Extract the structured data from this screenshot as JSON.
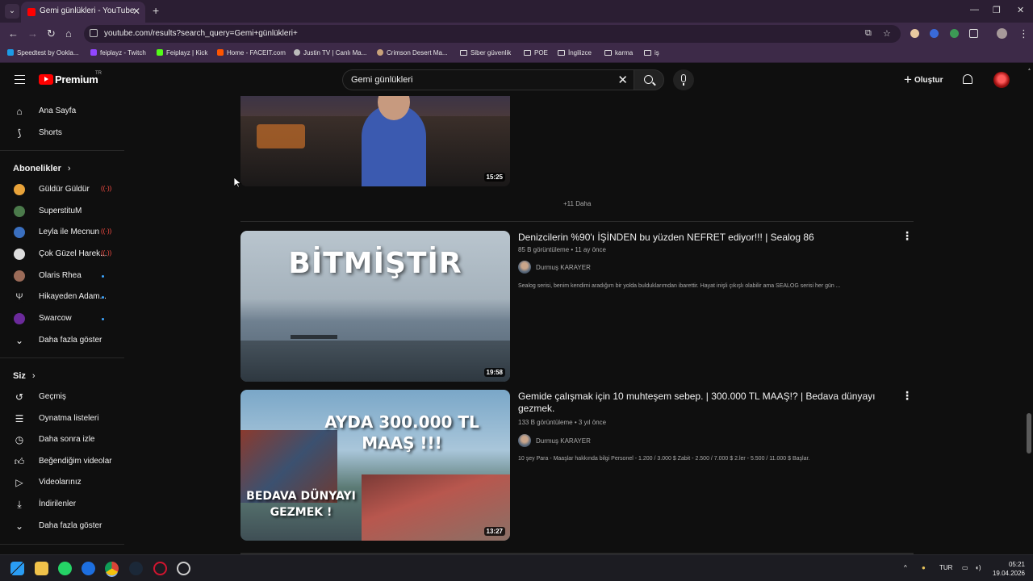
{
  "browser": {
    "tab_title": "Gemi günlükleri - YouTube",
    "url": "youtube.com/results?search_query=Gemi+günlükleri+",
    "bookmarks": [
      {
        "label": "Speedtest by Ookla...",
        "color": "#1c9be6",
        "folder": false
      },
      {
        "label": "feiplayz - Twitch",
        "color": "#9146ff",
        "folder": false
      },
      {
        "label": "Feiplayz | Kick",
        "color": "#53fc18",
        "folder": false
      },
      {
        "label": "Home - FACEIT.com",
        "color": "#ff5500",
        "folder": false
      },
      {
        "label": "Justin TV | Canlı Ma...",
        "color": "#bbbbbb",
        "folder": false
      },
      {
        "label": "Crimson Desert Ma...",
        "color": "#c9a27a",
        "folder": false
      },
      {
        "label": "Siber güvenlik",
        "color": "",
        "folder": true
      },
      {
        "label": "POE",
        "color": "",
        "folder": true
      },
      {
        "label": "İngilizce",
        "color": "",
        "folder": true
      },
      {
        "label": "karma",
        "color": "",
        "folder": true
      },
      {
        "label": "iş",
        "color": "",
        "folder": true
      }
    ]
  },
  "header": {
    "brand": "Premium",
    "region": "TR",
    "search_value": "Gemi günlükleri",
    "create_label": "Oluştur"
  },
  "sidebar": {
    "top": [
      {
        "label": "Ana Sayfa",
        "icon": "home-icon"
      },
      {
        "label": "Shorts",
        "icon": "shorts-icon"
      }
    ],
    "subscriptions_title": "Abonelikler",
    "subscriptions": [
      {
        "label": "Güldür Güldür",
        "indicator": "live",
        "color": "#e8a33a"
      },
      {
        "label": "SuperstituM",
        "indicator": "none",
        "color": "#4b7a4b"
      },
      {
        "label": "Leyla ile Mecnun",
        "indicator": "live",
        "color": "#3a6fbf"
      },
      {
        "label": "Çok Güzel Harek...",
        "indicator": "live",
        "color": "#dddddd"
      },
      {
        "label": "Olaris Rhea",
        "indicator": "dot",
        "color": "#9b6b58"
      },
      {
        "label": "Hikayeden Adam...",
        "indicator": "dot",
        "color": "#cccccc"
      },
      {
        "label": "Swarcow",
        "indicator": "dot",
        "color": "#6b2a9b"
      }
    ],
    "show_more": "Daha fazla göster",
    "you_title": "Siz",
    "you_items": [
      {
        "label": "Geçmiş",
        "icon": "history-icon"
      },
      {
        "label": "Oynatma listeleri",
        "icon": "playlist-icon"
      },
      {
        "label": "Daha sonra izle",
        "icon": "watch-later-icon"
      },
      {
        "label": "Beğendiğim videolar",
        "icon": "like-icon"
      },
      {
        "label": "Videolarınız",
        "icon": "your-videos-icon"
      },
      {
        "label": "İndirilenler",
        "icon": "download-icon"
      },
      {
        "label": "Daha fazla göster",
        "icon": "chevron-down-icon"
      }
    ]
  },
  "results": {
    "first_duration": "15:25",
    "more_label": "+11 Daha",
    "videos": [
      {
        "title": "Denizcilerin %90'ı İŞİNDEN bu yüzden NEFRET ediyor!!! | Sealog 86",
        "meta": "85 B görüntüleme • 11 ay önce",
        "channel": "Durmuş KARAYER",
        "description": "Sealog serisi, benim kendimi aradığım bir yolda bulduklarımdan ibarettir. Hayat inişli çıkışlı olabilir ama SEALOG serisi her gün ...",
        "duration": "19:58",
        "thumb_text": "BİTMİŞTİR"
      },
      {
        "title": "Gemide çalışmak için 10 muhteşem sebep. | 300.000 TL MAAŞ!? | Bedava dünyayı gezmek.",
        "meta": "133 B görüntüleme • 3 yıl önce",
        "channel": "Durmuş KARAYER",
        "description": "10 şey Para - Maaşlar hakkında bilgi Personel - 1.200 / 3.000 $ Zabit - 2.500 / 7.000 $ 2.ler - 5.500 / 11.000 $ Başlar.",
        "duration": "13:27",
        "thumb_text_top": "AYDA 300.000 TL MAAŞ !!!",
        "thumb_text_bottom": "BEDAVA DÜNYAYI GEZMEK !"
      }
    ]
  },
  "taskbar": {
    "lang": "TUR",
    "time": "05:21",
    "date": "19.04.2026"
  }
}
